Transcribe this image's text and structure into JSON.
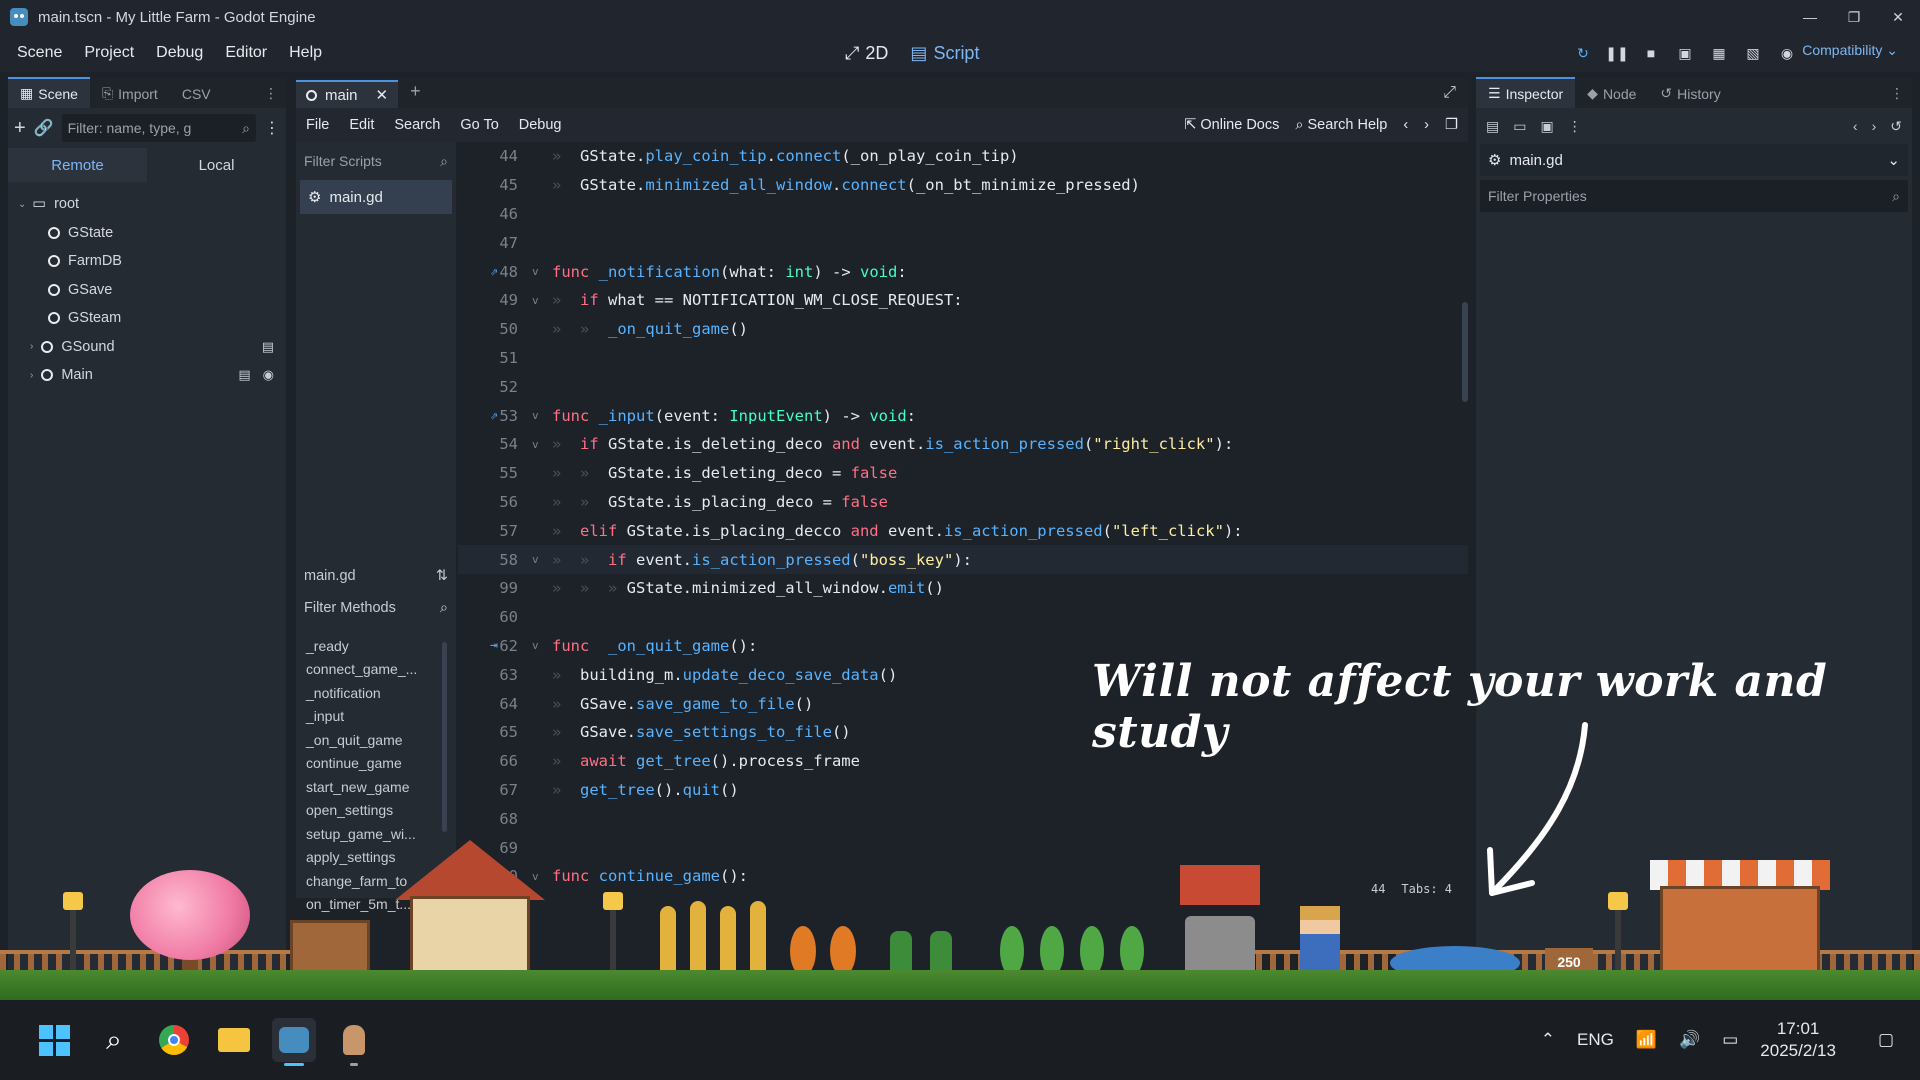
{
  "window": {
    "title": "main.tscn - My Little Farm - Godot Engine"
  },
  "menubar": {
    "items": [
      "Scene",
      "Project",
      "Debug",
      "Editor",
      "Help"
    ]
  },
  "workspace_tabs": {
    "twod": "2D",
    "script": "Script"
  },
  "renderer": "Compatibility",
  "scene_panel": {
    "tabs": [
      "Scene",
      "Import",
      "CSV"
    ],
    "filter_placeholder": "Filter: name, type, g",
    "remote": "Remote",
    "local": "Local",
    "nodes": [
      "root",
      "GState",
      "FarmDB",
      "GSave",
      "GSteam",
      "GSound",
      "Main"
    ]
  },
  "script_editor": {
    "tab": "main",
    "menu": [
      "File",
      "Edit",
      "Search",
      "Go To",
      "Debug"
    ],
    "online_docs": "Online Docs",
    "search_help": "Search Help",
    "filter_scripts": "Filter Scripts",
    "selected_script": "main.gd",
    "current_script": "main.gd",
    "filter_methods": "Filter Methods",
    "methods": [
      "_ready",
      "connect_game_...",
      "_notification",
      "_input",
      "_on_quit_game",
      "continue_game",
      "start_new_game",
      "open_settings",
      "setup_game_wi...",
      "apply_settings",
      "change_farm_to",
      "on_timer_5m_t..."
    ],
    "lines": [
      {
        "n": "44",
        "parts": [
          [
            "tab",
            "»  "
          ],
          [
            "cn",
            "GState."
          ],
          [
            "fn",
            "play_coin_tip"
          ],
          [
            "cn",
            "."
          ],
          [
            "fn",
            "connect"
          ],
          [
            "cn",
            "(_on_play_coin_tip)"
          ]
        ]
      },
      {
        "n": "45",
        "parts": [
          [
            "tab",
            "»  "
          ],
          [
            "cn",
            "GState."
          ],
          [
            "fn",
            "minimized_all_window"
          ],
          [
            "cn",
            "."
          ],
          [
            "fn",
            "connect"
          ],
          [
            "cn",
            "(_on_bt_minimize_pressed)"
          ]
        ]
      },
      {
        "n": "46",
        "parts": []
      },
      {
        "n": "47",
        "parts": []
      },
      {
        "n": "48",
        "icon": "⇗",
        "fold": "v",
        "parts": [
          [
            "kw",
            "func "
          ],
          [
            "fn",
            "_notification"
          ],
          [
            "cn",
            "(what: "
          ],
          [
            "ty",
            "int"
          ],
          [
            "cn",
            ") -> "
          ],
          [
            "ty",
            "void"
          ],
          [
            "cn",
            ":"
          ]
        ]
      },
      {
        "n": "49",
        "fold": "v",
        "parts": [
          [
            "tab",
            "»  "
          ],
          [
            "kw",
            "if "
          ],
          [
            "cn",
            "what == NOTIFICATION_WM_CLOSE_REQUEST:"
          ]
        ]
      },
      {
        "n": "50",
        "parts": [
          [
            "tab",
            "»  »  "
          ],
          [
            "fn",
            "_on_quit_game"
          ],
          [
            "cn",
            "()"
          ]
        ]
      },
      {
        "n": "51",
        "parts": []
      },
      {
        "n": "52",
        "parts": []
      },
      {
        "n": "53",
        "icon": "⇗",
        "fold": "v",
        "parts": [
          [
            "kw",
            "func "
          ],
          [
            "fn",
            "_input"
          ],
          [
            "cn",
            "(event: "
          ],
          [
            "ty",
            "InputEvent"
          ],
          [
            "cn",
            ") -> "
          ],
          [
            "ty",
            "void"
          ],
          [
            "cn",
            ":"
          ]
        ]
      },
      {
        "n": "54",
        "fold": "v",
        "parts": [
          [
            "tab",
            "»  "
          ],
          [
            "kw",
            "if "
          ],
          [
            "cn",
            "GState.is_deleting_deco "
          ],
          [
            "kw",
            "and "
          ],
          [
            "cn",
            "event."
          ],
          [
            "fn",
            "is_action_pressed"
          ],
          [
            "cn",
            "("
          ],
          [
            "str",
            "\"right_click\""
          ],
          [
            "cn",
            "):"
          ]
        ]
      },
      {
        "n": "55",
        "parts": [
          [
            "tab",
            "»  »  "
          ],
          [
            "cn",
            "GState.is_deleting_deco = "
          ],
          [
            "kw",
            "false"
          ]
        ]
      },
      {
        "n": "56",
        "parts": [
          [
            "tab",
            "»  »  "
          ],
          [
            "cn",
            "GState.is_placing_deco = "
          ],
          [
            "kw",
            "false"
          ]
        ]
      },
      {
        "n": "57",
        "parts": [
          [
            "tab",
            "»  "
          ],
          [
            "kw",
            "elif "
          ],
          [
            "cn",
            "GState.is_placing_decco "
          ],
          [
            "kw",
            "and "
          ],
          [
            "cn",
            "event."
          ],
          [
            "fn",
            "is_action_pressed"
          ],
          [
            "cn",
            "("
          ],
          [
            "str",
            "\"left_click\""
          ],
          [
            "cn",
            "):"
          ]
        ]
      },
      {
        "n": "58",
        "fold": "v",
        "cur": true,
        "parts": [
          [
            "tab",
            "»  »  "
          ],
          [
            "kw",
            "if "
          ],
          [
            "cn",
            "event."
          ],
          [
            "fn",
            "is_action_pressed"
          ],
          [
            "cn",
            "("
          ],
          [
            "str",
            "\"boss_key\""
          ],
          [
            "cn",
            "):"
          ]
        ]
      },
      {
        "n": "99",
        "parts": [
          [
            "tab",
            "»  »  » "
          ],
          [
            "cn",
            "GState.minimized_all_window."
          ],
          [
            "fn",
            "emit"
          ],
          [
            "cn",
            "()"
          ]
        ]
      },
      {
        "n": "60",
        "parts": []
      },
      {
        "n": "62",
        "icon": "⇥",
        "fold": "v",
        "parts": [
          [
            "kw",
            "func "
          ],
          [
            "fn",
            " _on_quit_game"
          ],
          [
            "cn",
            "():"
          ]
        ]
      },
      {
        "n": "63",
        "parts": [
          [
            "tab",
            "»  "
          ],
          [
            "cn",
            "building_m."
          ],
          [
            "fn",
            "update_deco_save_data"
          ],
          [
            "cn",
            "()"
          ]
        ]
      },
      {
        "n": "64",
        "parts": [
          [
            "tab",
            "»  "
          ],
          [
            "cn",
            "GSave."
          ],
          [
            "fn",
            "save_game_to_file"
          ],
          [
            "cn",
            "()"
          ]
        ]
      },
      {
        "n": "65",
        "parts": [
          [
            "tab",
            "»  "
          ],
          [
            "cn",
            "GSave."
          ],
          [
            "fn",
            "save_settings_to_file"
          ],
          [
            "cn",
            "()"
          ]
        ]
      },
      {
        "n": "66",
        "parts": [
          [
            "tab",
            "»  "
          ],
          [
            "kw",
            "await "
          ],
          [
            "fn",
            "get_tree"
          ],
          [
            "cn",
            "().process_frame"
          ]
        ]
      },
      {
        "n": "67",
        "parts": [
          [
            "tab",
            "»  "
          ],
          [
            "fn",
            "get_tree"
          ],
          [
            "cn",
            "()."
          ],
          [
            "fn",
            "quit"
          ],
          [
            "cn",
            "()"
          ]
        ]
      },
      {
        "n": "68",
        "parts": []
      },
      {
        "n": "69",
        "parts": []
      },
      {
        "n": "70",
        "fold": "v",
        "parts": [
          [
            "kw",
            "func "
          ],
          [
            "fn",
            "continue_game"
          ],
          [
            "cn",
            "():"
          ]
        ]
      }
    ],
    "status": {
      "col": "44",
      "tabs": "Tabs: 4"
    }
  },
  "inspector": {
    "tabs": [
      "Inspector",
      "Node",
      "History"
    ],
    "resource": "main.gd",
    "filter_placeholder": "Filter Properties"
  },
  "overlay": {
    "caption": "Will not affect your work and study",
    "sign_value": "250"
  },
  "taskbar": {
    "lang": "ENG",
    "time": "17:01",
    "date": "2025/2/13"
  },
  "colors": {
    "accent": "#4d92e0",
    "keyword": "#ff7085",
    "function": "#57b3ff",
    "type": "#42ffc2",
    "string": "#ffeda1"
  }
}
